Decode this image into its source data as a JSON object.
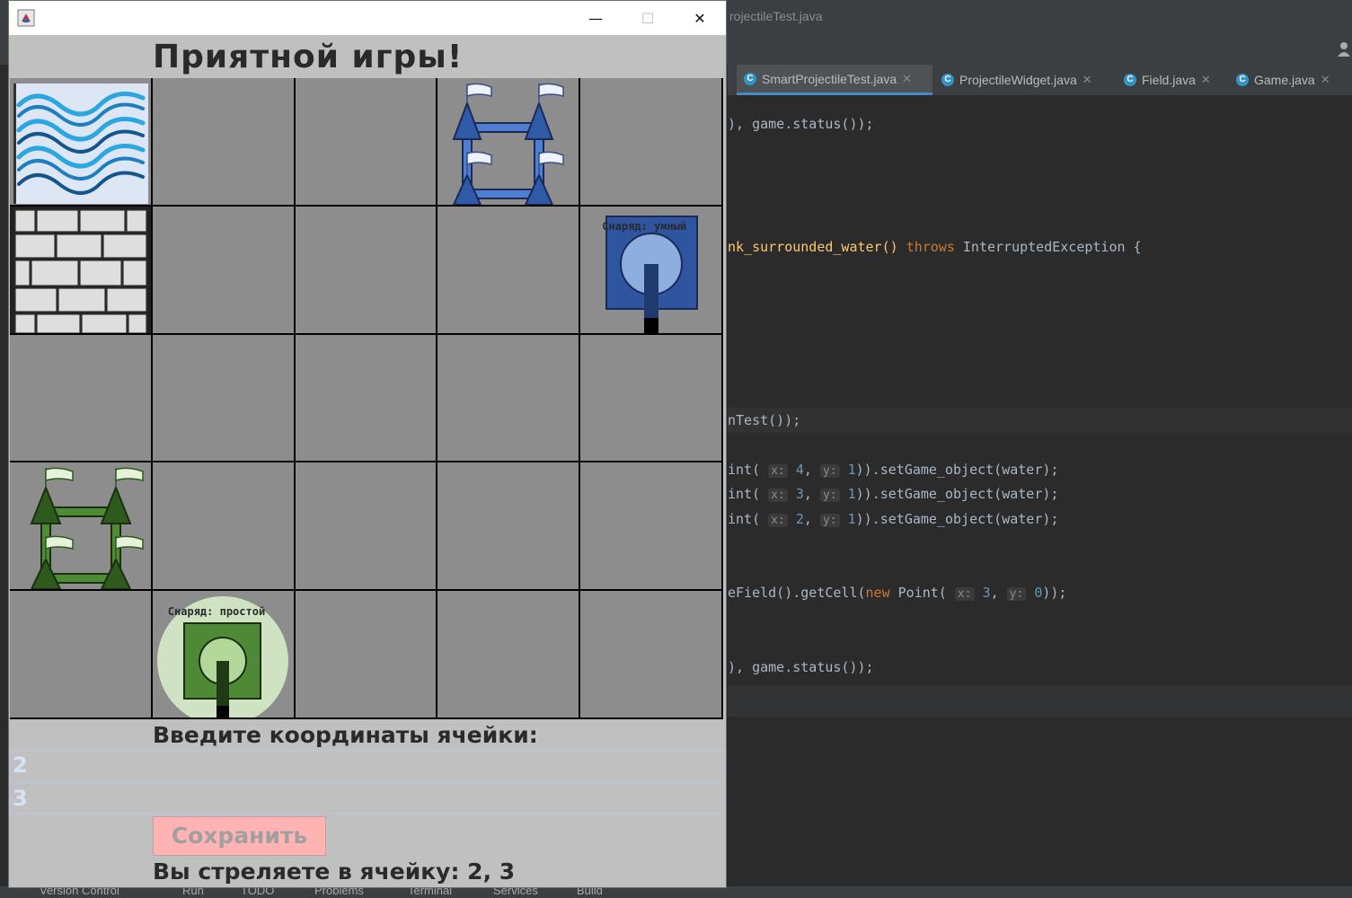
{
  "ide": {
    "title": "rojectileTest.java",
    "tabs": [
      {
        "label": "SmartProjectileTest.java",
        "active": true,
        "icon": "test-class-icon"
      },
      {
        "label": "ProjectileWidget.java",
        "active": false,
        "icon": "class-icon"
      },
      {
        "label": "Field.java",
        "active": false,
        "icon": "class-icon"
      },
      {
        "label": "Game.java",
        "active": false,
        "icon": "class-icon"
      }
    ],
    "code": {
      "l1_a": "), game.status());",
      "l2_a": "nk_surrounded_water() ",
      "l2_kw": "throws",
      "l2_b": " InterruptedException {",
      "l3_a": "nTest());",
      "l4": {
        "pre": "int(",
        "xh": "x:",
        "xv": "4",
        "yh": "y:",
        "yv": "1",
        "post": ")).setGame_object(water);"
      },
      "l5": {
        "pre": "int(",
        "xh": "x:",
        "xv": "3",
        "yh": "y:",
        "yv": "1",
        "post": ")).setGame_object(water);"
      },
      "l6": {
        "pre": "int(",
        "xh": "x:",
        "xv": "2",
        "yh": "y:",
        "yv": "1",
        "post": ")).setGame_object(water);"
      },
      "l7": {
        "pre": "eField().getCell(",
        "kw": "new",
        "mid": " Point(",
        "xh": "x:",
        "xv": "3",
        "yh": "y:",
        "yv": "0",
        "post": "));"
      },
      "l8_a": "), game.status());"
    },
    "status_bar": [
      "Version Control",
      "Run",
      "TODO",
      "Problems",
      "Terminal",
      "Services",
      "Build"
    ]
  },
  "game": {
    "window": {
      "minimize": "—",
      "maximize": "☐",
      "close": "✕"
    },
    "title": "Приятной игры!",
    "board": {
      "rows": 5,
      "cols": 5,
      "cells": {
        "water": "water-tile",
        "castle_blue": "blue-castle",
        "wall": "brick-wall",
        "tank_blue": "blue-tank",
        "castle_green": "green-castle",
        "tank_green": "green-tank"
      },
      "blue_tank_label": "Снаряд: умный",
      "green_tank_label": "Снаряд: простой"
    },
    "prompt": "Введите координаты ячейки:",
    "input_x": "2",
    "input_y": "3",
    "save_label": "Сохранить",
    "status": "Вы стреляете в ячейку: 2, 3",
    "colors": {
      "board_cell": "#8d8d8d",
      "blue_tank": "#2f55a0",
      "green_tank": "#4e8a35",
      "save_button": "#ffb3b3"
    }
  }
}
